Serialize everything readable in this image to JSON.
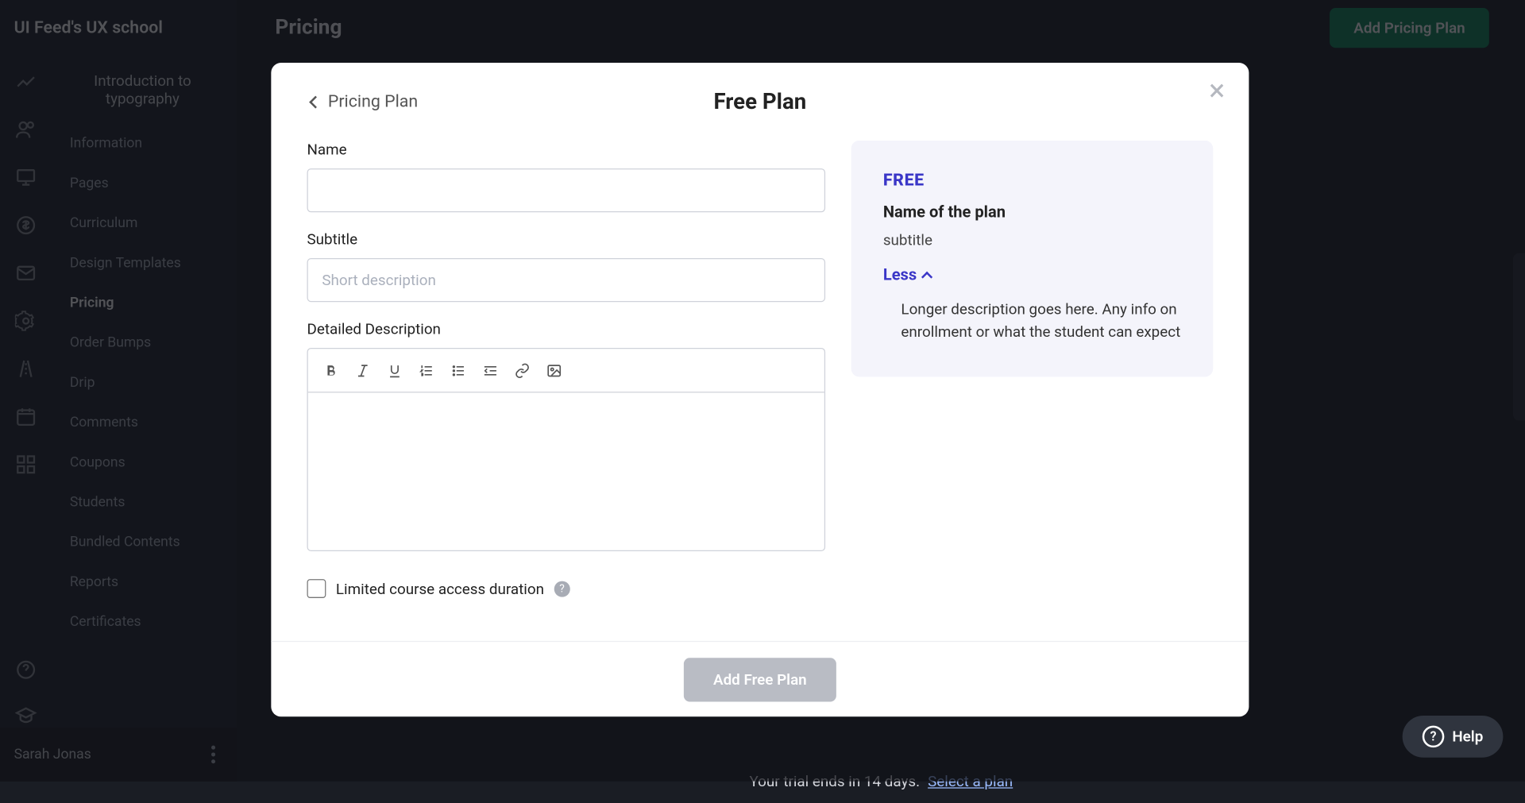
{
  "brand": "UI Feed's UX school",
  "course_title": "Introduction to typography",
  "sidebar": {
    "items": [
      {
        "label": "Information"
      },
      {
        "label": "Pages"
      },
      {
        "label": "Curriculum"
      },
      {
        "label": "Design Templates"
      },
      {
        "label": "Pricing"
      },
      {
        "label": "Order Bumps"
      },
      {
        "label": "Drip"
      },
      {
        "label": "Comments"
      },
      {
        "label": "Coupons"
      },
      {
        "label": "Students"
      },
      {
        "label": "Bundled Contents"
      },
      {
        "label": "Reports"
      },
      {
        "label": "Certificates"
      }
    ]
  },
  "user_name": "Sarah Jonas",
  "page": {
    "title": "Pricing",
    "add_button": "Add Pricing Plan"
  },
  "modal": {
    "breadcrumb": "Pricing Plan",
    "title": "Free Plan",
    "labels": {
      "name": "Name",
      "subtitle": "Subtitle",
      "detailed": "Detailed Description"
    },
    "subtitle_placeholder": "Short description",
    "name_value": "",
    "checkbox_label": "Limited course access duration",
    "submit": "Add Free Plan"
  },
  "preview": {
    "price": "FREE",
    "name": "Name of the plan",
    "subtitle": "subtitle",
    "toggle": "Less",
    "long": "Longer description goes here. Any info on enrollment or what the student can expect"
  },
  "trial": {
    "text": "Your trial ends in 14 days.",
    "link": "Select a plan"
  },
  "help": "Help"
}
